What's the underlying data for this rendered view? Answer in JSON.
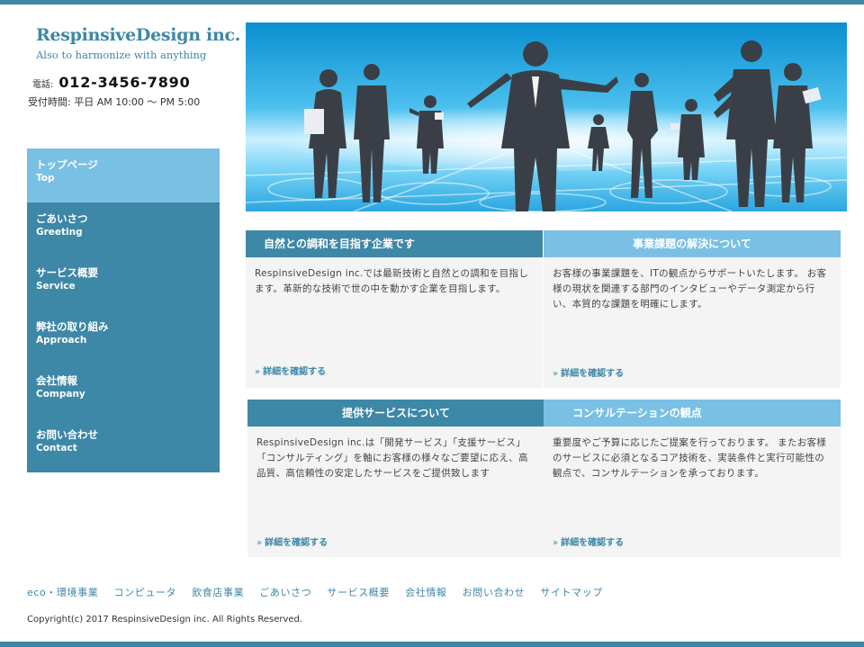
{
  "site": {
    "logo": "RespinsiveDesign inc.",
    "tagline": "Also to harmonize with anything",
    "phone_label": "電話:",
    "phone_number": "012-3456-7890",
    "hours": "受付時間: 平日 AM 10:00 〜 PM 5:00"
  },
  "nav": {
    "items": [
      {
        "jp": "トップページ",
        "en": "Top"
      },
      {
        "jp": "ごあいさつ",
        "en": "Greeting"
      },
      {
        "jp": "サービス概要",
        "en": "Service"
      },
      {
        "jp": "弊社の取り組み",
        "en": "Approach"
      },
      {
        "jp": "会社情報",
        "en": "Company"
      },
      {
        "jp": "お問い合わせ",
        "en": "Contact"
      }
    ]
  },
  "cards": [
    {
      "title": "自然との調和を目指す企業です",
      "body": "RespinsiveDesign inc.では最新技術と自然との調和を目指します。革新的な技術で世の中を動かす企業を目指します。",
      "link": "詳細を確認する"
    },
    {
      "title": "事業課題の解決について",
      "body": "お客様の事業課題を、ITの観点からサポートいたします。 お客様の現状を関連する部門のインタビューやデータ測定から行い、本質的な課題を明確にします。",
      "link": "詳細を確認する"
    },
    {
      "title": "提供サービスについて",
      "body": "RespinsiveDesign inc.は「開発サービス」「支援サービス」「コンサルティング」を軸にお客様の様々なご要望に応え、高品質、高信頼性の安定したサービスをご提供致します",
      "link": "詳細を確認する"
    },
    {
      "title": "コンサルテーションの観点",
      "body": "重要度やご予算に応じたご提案を行っております。 またお客様のサービスに必須となるコア技術を、実装条件と実行可能性の観点で、コンサルテーションを承っております。",
      "link": "詳細を確認する"
    }
  ],
  "footer": {
    "links": [
      "eco・環境事業",
      "コンピュータ",
      "飲食店事業",
      "ごあいさつ",
      "サービス概要",
      "会社情報",
      "お問い合わせ",
      "サイトマップ"
    ],
    "copyright": "Copyright(c) 2017 RespinsiveDesign inc. All Rights Reserved."
  },
  "colors": {
    "accent": "#3d87a7",
    "accent_light": "#79c0e4",
    "card_bg": "#f4f4f4"
  },
  "icons": {
    "card_link_arrow": "double-chevron-right-icon"
  }
}
